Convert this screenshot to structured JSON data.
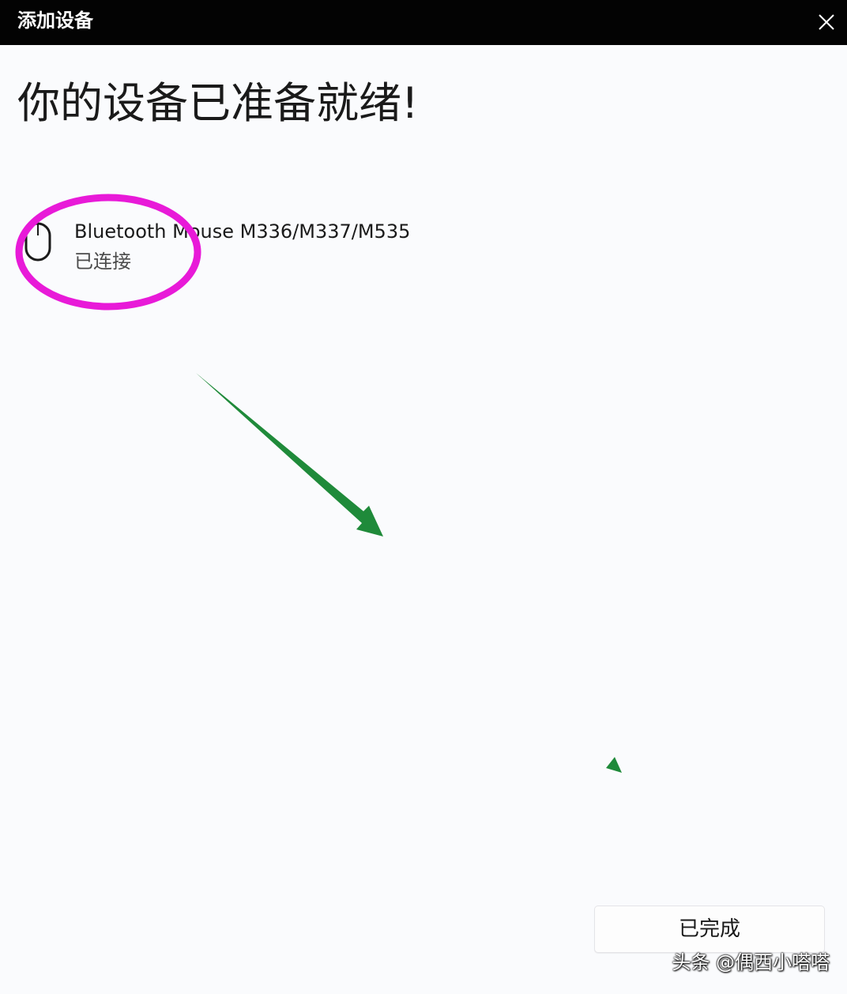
{
  "window": {
    "title": "添加设备"
  },
  "main": {
    "heading": "你的设备已准备就绪!",
    "device": {
      "name": "Bluetooth Mouse M336/M337/M535",
      "status": "已连接",
      "icon": "mouse-icon"
    },
    "done_button": "已完成"
  },
  "watermark": "头条 @偶西小嗒嗒",
  "annotations": {
    "circle_color": "#e81ad8",
    "arrow_color": "#1f8a3a"
  }
}
